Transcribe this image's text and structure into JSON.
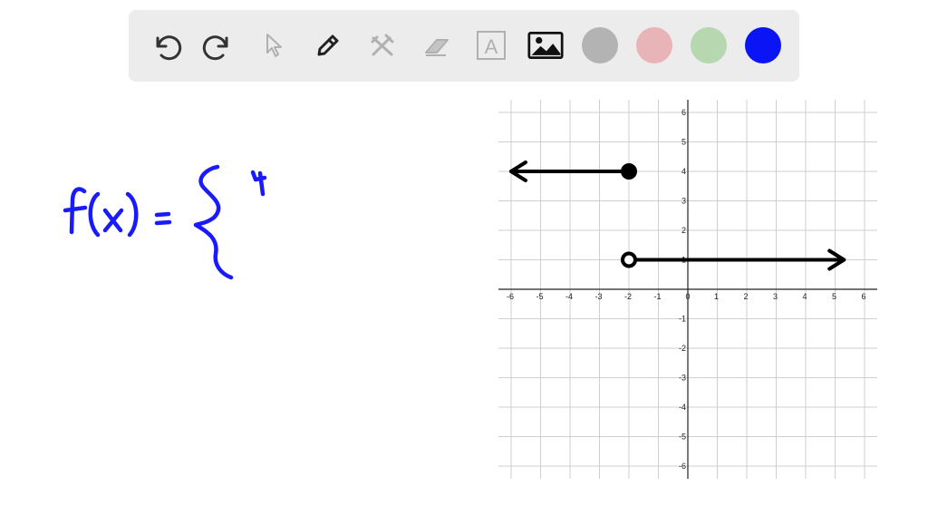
{
  "app": {
    "title": ""
  },
  "toolbar": {
    "tools": [
      {
        "name": "undo-button",
        "icon": "undo-icon",
        "enabled": true
      },
      {
        "name": "redo-button",
        "icon": "redo-icon",
        "enabled": true
      },
      {
        "name": "select-tool-button",
        "icon": "cursor-arrow-icon",
        "enabled": false
      },
      {
        "name": "pen-tool-button",
        "icon": "pencil-icon",
        "enabled": true
      },
      {
        "name": "tools-button",
        "icon": "wrench-hammer-icon",
        "enabled": false
      },
      {
        "name": "eraser-tool-button",
        "icon": "eraser-icon",
        "enabled": false
      },
      {
        "name": "text-tool-button",
        "icon": "text-box-icon",
        "enabled": false,
        "glyph": "A"
      },
      {
        "name": "image-tool-button",
        "icon": "image-icon",
        "enabled": true
      }
    ],
    "colors": [
      {
        "name": "color-gray",
        "hex": "#b3b3b3"
      },
      {
        "name": "color-pink",
        "hex": "#e8b4b8"
      },
      {
        "name": "color-green",
        "hex": "#b6d7b0"
      },
      {
        "name": "color-blue",
        "hex": "#0a14f5",
        "selected": true
      }
    ]
  },
  "colors": {
    "ink_blue": "#1a1aff",
    "ink_black": "#000000",
    "grid": "#cfcfcf",
    "axis": "#222222"
  },
  "handwriting": {
    "formula": "f(x) = {",
    "note": "4"
  },
  "chart_data": {
    "type": "line",
    "title": "",
    "xlabel": "",
    "ylabel": "",
    "xlim": [
      -6,
      6
    ],
    "ylim": [
      -6,
      6
    ],
    "x_ticks": [
      -6,
      -5,
      -4,
      -3,
      -2,
      -1,
      0,
      1,
      2,
      3,
      4,
      5,
      6
    ],
    "y_ticks": [
      -6,
      -5,
      -4,
      -3,
      -2,
      -1,
      1,
      2,
      3,
      4,
      5,
      6
    ],
    "grid": true,
    "series": [
      {
        "x": [
          -6,
          -2
        ],
        "y": [
          4,
          4
        ],
        "left_end": "arrow",
        "right_end": "closed-dot"
      },
      {
        "x": [
          -2,
          5.3
        ],
        "y": [
          1,
          1
        ],
        "left_end": "open-dot",
        "right_end": "arrow"
      }
    ]
  }
}
